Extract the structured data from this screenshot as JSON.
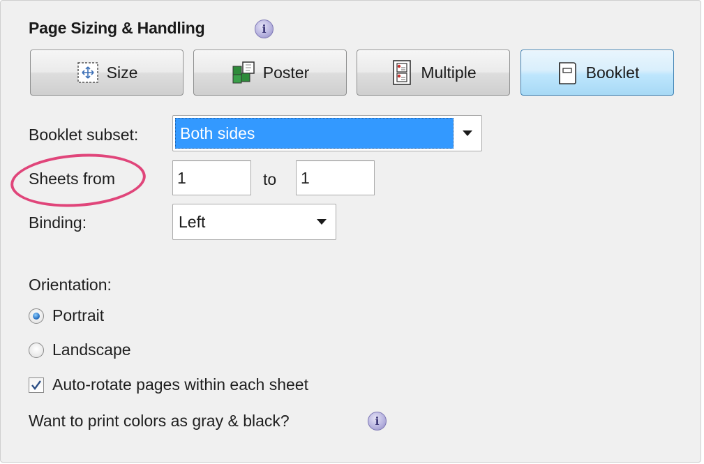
{
  "section": {
    "title": "Page Sizing & Handling"
  },
  "modes": [
    {
      "label": "Size",
      "icon": "size-icon",
      "selected": false
    },
    {
      "label": "Poster",
      "icon": "poster-icon",
      "selected": false
    },
    {
      "label": "Multiple",
      "icon": "multiple-icon",
      "selected": false
    },
    {
      "label": "Booklet",
      "icon": "booklet-icon",
      "selected": true
    }
  ],
  "booklet_subset": {
    "label": "Booklet subset:",
    "value": "Both sides"
  },
  "sheets": {
    "label": "Sheets from",
    "from_value": "1",
    "to_label": "to",
    "to_value": "1"
  },
  "binding": {
    "label": "Binding:",
    "value": "Left"
  },
  "orientation": {
    "label": "Orientation:",
    "options": [
      {
        "label": "Portrait",
        "selected": true
      },
      {
        "label": "Landscape",
        "selected": false
      }
    ]
  },
  "auto_rotate": {
    "label": "Auto-rotate pages within each sheet",
    "checked": true
  },
  "gray_print": {
    "label": "Want to print colors as gray & black?"
  },
  "colors": {
    "accent": "#3399ff",
    "selected_button": "#bee6fd",
    "annotation_ring": "#e0457a"
  }
}
